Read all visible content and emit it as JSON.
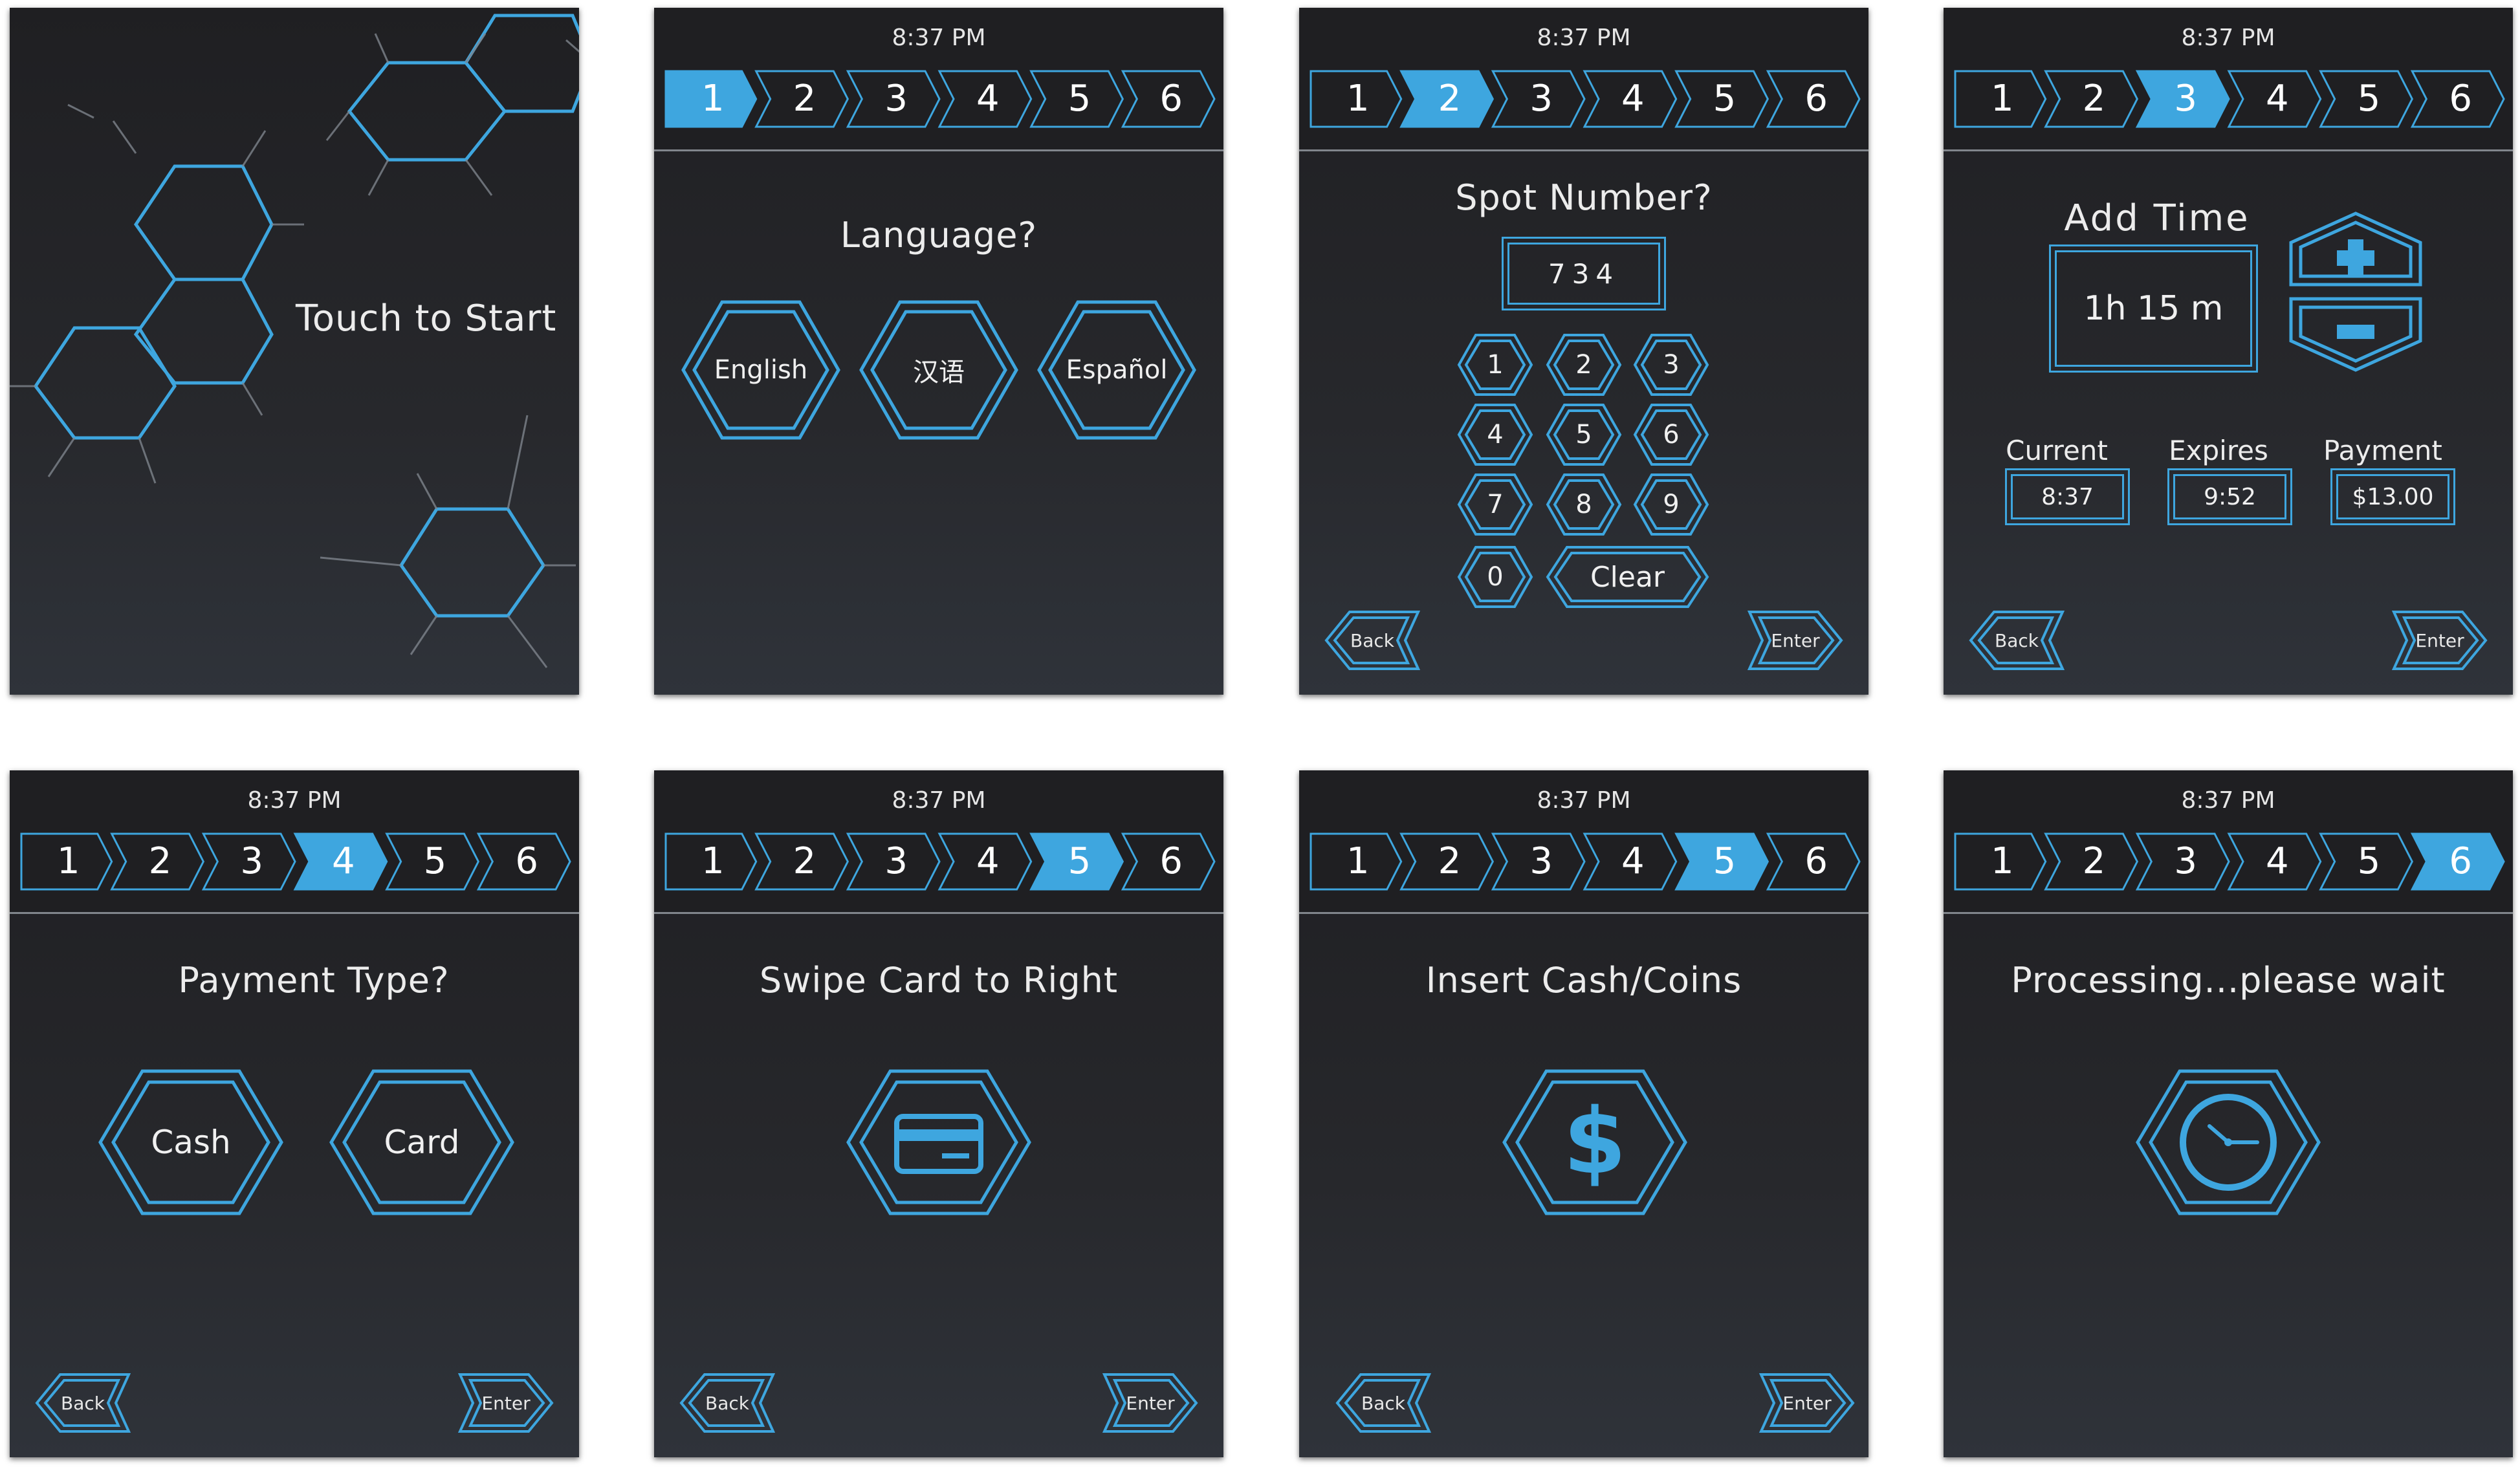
{
  "accent_color": "#3ea6df",
  "clock": "8:37 PM",
  "steps": [
    "1",
    "2",
    "3",
    "4",
    "5",
    "6"
  ],
  "start_screen": {
    "title": "Touch to Start"
  },
  "language_screen": {
    "title": "Language?",
    "options": [
      "English",
      "汉语",
      "Español"
    ]
  },
  "spot_screen": {
    "title": "Spot Number?",
    "value": "734",
    "keys": [
      "1",
      "2",
      "3",
      "4",
      "5",
      "6",
      "7",
      "8",
      "9",
      "0"
    ],
    "clear_label": "Clear"
  },
  "time_screen": {
    "title": "Add Time",
    "duration": "1h 15 m",
    "plus_icon": "plus-icon",
    "minus_icon": "minus-icon",
    "current_label": "Current",
    "current_value": "8:37",
    "expires_label": "Expires",
    "expires_value": "9:52",
    "payment_label": "Payment",
    "payment_value": "$13.00"
  },
  "payment_screen": {
    "title": "Payment Type?",
    "options": [
      "Cash",
      "Card"
    ]
  },
  "swipe_screen": {
    "title": "Swipe Card to Right",
    "icon": "credit-card-icon"
  },
  "cash_screen": {
    "title": "Insert Cash/Coins",
    "icon": "dollar-icon"
  },
  "processing_screen": {
    "title": "Processing...please wait",
    "icon": "clock-icon"
  },
  "nav": {
    "back": "Back",
    "enter": "Enter"
  }
}
